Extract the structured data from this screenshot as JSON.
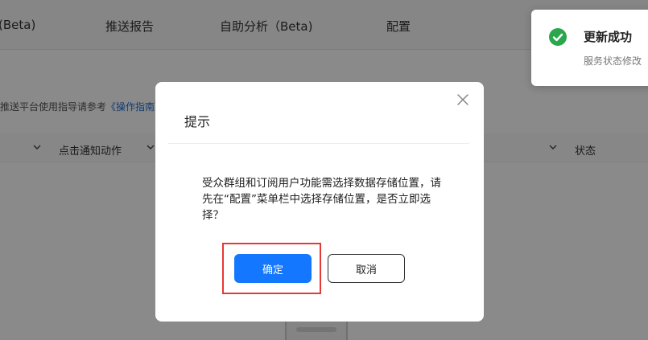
{
  "nav": {
    "items": [
      "(Beta)",
      "推送报告",
      "自助分析（Beta)",
      "配置"
    ]
  },
  "hint": {
    "text": "推送平台使用指导请参考",
    "link": "《操作指南》"
  },
  "table": {
    "col_action": "点击通知动作",
    "col_status": "状态"
  },
  "toast": {
    "title": "更新成功",
    "description": "服务状态修改",
    "icon": "check-circle-icon",
    "icon_color": "#2aa64c"
  },
  "modal": {
    "title": "提示",
    "body": "受众群组和订阅用户功能需选择数据存储位置，请先在“配置”菜单栏中选择存储位置，是否立即选择？",
    "confirm_label": "确定",
    "cancel_label": "取消",
    "close_icon": "close-icon",
    "accent_color": "#1477ff",
    "highlight_color": "#e53935"
  }
}
